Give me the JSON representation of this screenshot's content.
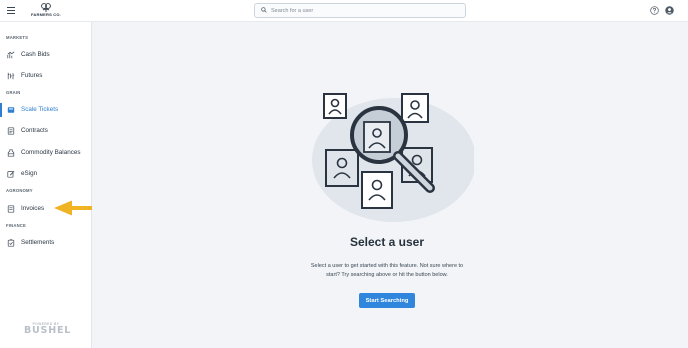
{
  "header": {
    "brand_name": "FARMERS CO.",
    "search_placeholder": "Search for a user",
    "icons": [
      "hamburger-icon",
      "search-icon",
      "help-icon",
      "account-icon"
    ]
  },
  "sidebar": {
    "sections": {
      "markets": "MARKETS",
      "grain": "GRAIN",
      "agronomy": "AGRONOMY",
      "finance": "FINANCE"
    },
    "items": [
      {
        "label": "Cash Bids",
        "icon": "cash-bids-icon"
      },
      {
        "label": "Futures",
        "icon": "futures-icon"
      },
      {
        "label": "Scale Tickets",
        "icon": "scale-tickets-icon",
        "active": true
      },
      {
        "label": "Contracts",
        "icon": "contracts-icon"
      },
      {
        "label": "Commodity Balances",
        "icon": "commodity-balances-icon"
      },
      {
        "label": "eSign",
        "icon": "esign-icon"
      },
      {
        "label": "Invoices",
        "icon": "invoices-icon"
      },
      {
        "label": "Settlements",
        "icon": "settlements-icon"
      }
    ],
    "powered_by": "POWERED BY",
    "powered_brand": "BUSHEL"
  },
  "main": {
    "title": "Select a user",
    "description": "Select a user to get started with this feature. Not sure where to start? Try searching above or hit the button below.",
    "button_label": "Start Searching"
  },
  "colors": {
    "accent": "#2c7fd1",
    "button": "#2f86dc",
    "annotation_arrow": "#f0b323",
    "main_bg": "#f2f4f7"
  }
}
